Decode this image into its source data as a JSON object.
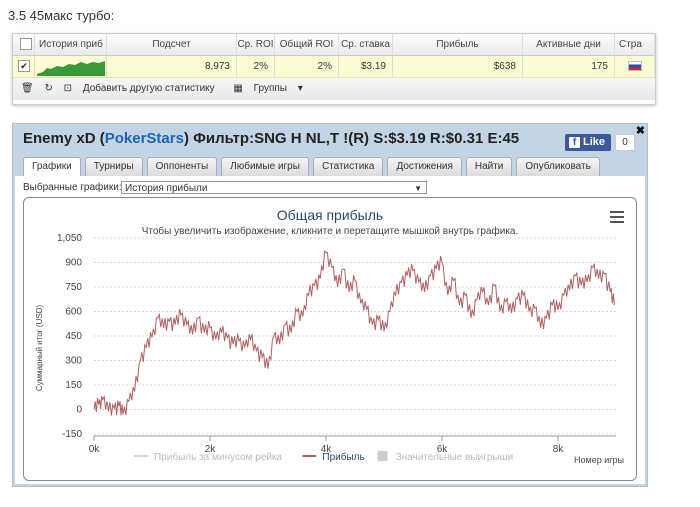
{
  "caption": "3.5 45макс турбо:",
  "stats": {
    "headers": [
      "",
      "История приб",
      "Подсчет",
      "Ср. ROI",
      "Общий ROI",
      "Ср. ставка",
      "Прибыль",
      "Активные дни",
      "Стра"
    ],
    "row": {
      "count": "8,973",
      "avg_roi": "2%",
      "total_roi": "2%",
      "avg_stake": "$3.19",
      "profit": "$638",
      "active_days": "175"
    },
    "toolbar": {
      "add_label": "Добавить другую статистику",
      "groups_label": "Группы"
    }
  },
  "panel": {
    "name": "Enemy xD",
    "site": "PokerStars",
    "filter_text": " Фильтр:SNG H NL,T !(R) S:$3.19 R:$0.31 E:45",
    "fb_like": "Like",
    "fb_count": "0",
    "tabs": [
      "Графики",
      "Турниры",
      "Оппоненты",
      "Любимые игры",
      "Статистика",
      "Достижения",
      "Найти",
      "Опубликовать"
    ],
    "select_label": "Выбранные графики:",
    "select_value": "История прибыли"
  },
  "chart_data": {
    "type": "line",
    "title": "Общая прибыль",
    "subtitle": "Чтобы увеличить изображение, кликните и перетащите мышкой внутрь графика.",
    "ylabel": "Суммарный итог (USD)",
    "xlabel": "Номер игры",
    "ylim": [
      -150,
      1050
    ],
    "xlim": [
      0,
      9000
    ],
    "yticks": [
      "1,050",
      "900",
      "750",
      "600",
      "450",
      "300",
      "150",
      "0",
      "-150"
    ],
    "xticks": [
      "0k",
      "2k",
      "4k",
      "6k",
      "8k"
    ],
    "legend": [
      "Прибыль за минусом рейка",
      "Прибыль",
      "Значительные выигрыши"
    ],
    "series": [
      {
        "name": "Прибыль",
        "color": "#b06060",
        "x": [
          0,
          80,
          150,
          250,
          350,
          430,
          500,
          600,
          700,
          800,
          900,
          1000,
          1100,
          1200,
          1300,
          1400,
          1500,
          1600,
          1700,
          1800,
          1900,
          2000,
          2100,
          2200,
          2300,
          2400,
          2500,
          2600,
          2700,
          2800,
          2900,
          3000,
          3100,
          3200,
          3300,
          3400,
          3500,
          3600,
          3700,
          3800,
          3900,
          4000,
          4100,
          4200,
          4300,
          4400,
          4500,
          4600,
          4700,
          4800,
          4900,
          5000,
          5100,
          5200,
          5300,
          5400,
          5500,
          5600,
          5700,
          5800,
          5900,
          6000,
          6100,
          6200,
          6300,
          6400,
          6500,
          6600,
          6700,
          6800,
          6900,
          7000,
          7100,
          7200,
          7300,
          7400,
          7500,
          7600,
          7700,
          7800,
          7900,
          8000,
          8100,
          8200,
          8300,
          8400,
          8500,
          8600,
          8700,
          8800,
          8900,
          8973
        ],
        "y": [
          0,
          30,
          60,
          -10,
          10,
          20,
          -30,
          50,
          110,
          300,
          380,
          440,
          560,
          500,
          540,
          520,
          580,
          520,
          460,
          560,
          470,
          500,
          430,
          470,
          440,
          400,
          420,
          380,
          430,
          360,
          320,
          250,
          450,
          400,
          520,
          470,
          600,
          570,
          700,
          760,
          800,
          960,
          870,
          750,
          860,
          720,
          790,
          650,
          610,
          520,
          550,
          480,
          600,
          700,
          780,
          820,
          850,
          780,
          720,
          820,
          860,
          900,
          700,
          790,
          640,
          700,
          560,
          670,
          720,
          640,
          760,
          600,
          660,
          590,
          680,
          700,
          600,
          620,
          500,
          560,
          640,
          610,
          700,
          730,
          820,
          760,
          780,
          870,
          800,
          830,
          720,
          640
        ]
      }
    ]
  }
}
